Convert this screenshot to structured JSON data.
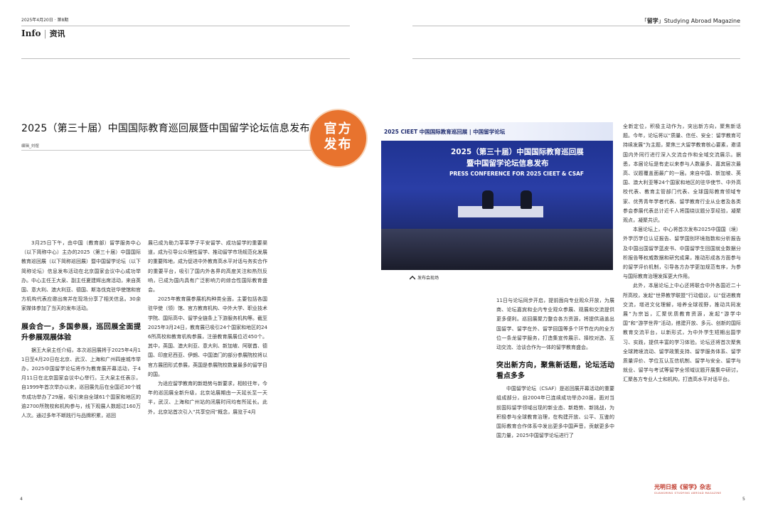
{
  "header": {
    "date_issue": "2025年4月20日 · 第8期",
    "section_en": "Info",
    "section_zh": "资讯",
    "magazine_bracket": "留学",
    "magazine_name": "Studying Abroad Magazine"
  },
  "article": {
    "title": "2025（第三十届）中国国际教育巡回展暨中国留学论坛信息发布",
    "editor": "编辑_刘煜",
    "badge": [
      "官方",
      "发布"
    ],
    "col1": {
      "p1": "3月25日下午，由中国（教育部）留学服务中心（以下简称中心）主办的2025（第三十届）中国国际教育巡回展（以下简称巡回展）暨中国留学论坛（以下简称论坛）信息发布活动在北京国家会议中心成功举办。中心主任王大泉、副主任夏建辉出席活动，来自英国、意大利、澳大利亚、德国、斯洛伐克驻华使馆和官方机构代表应邀出席并在现场分享了相关信息。30余家媒体参加了当天的发布活动。",
      "h1": "展会合一，多国参展，巡回展全面提升参展观展体验",
      "p2": "据王大泉主任介绍，本次巡回展将于2025年4月11日至4月20日在北京、武汉、上海和广州四座城市举办，2025中国留学论坛将作为教育展开幕活动，于4月11日在北京国家会议中心举行。王大泉主任表示，自1999年首次举办以来，巡回展先后在全国近30个城市成功举办了29届，吸引来自全球61个国家和地区的逾2700所院校和机构参与，线下观展人数超过160万人次。通过多年不断践行与品牌积累，巡回"
    },
    "col2": {
      "p1": "展已成为助力莘莘学子平安留学、成功留学的重要渠道，成为引导公众理性留学、推动留学市场规范化发展的重要阵地，成为促进中外教育高水平对话与务实合作的重要平台，吸引了国内外各界的高度关注和热烈反响，已成为国内具有广泛影响力的综合性国际教育盛会。",
      "p2": "2025年教育展参展机构种类全面，主要包括各国驻华使（领）馆、官方教育机构、中外大学、职业技术学院、国际高中、留学全链条上下游服务机构等。截至2025年3月24日，教育展已吸引24个国家和地区的246所高校和教育机构参展，注册教育展展位近450个。其中，英国、澳大利亚、意大利、新加坡、阿联酋、德国、印度尼西亚、伊朗、中国澳门的部分参展院校将以官方展团形式参展，英国是参展院校数量最多的留学目的国。",
      "p3": "为适应留学教育的新趋势与新要求，相较往年，今年的巡回展全新升级，北京站展期由一天延长至一天半，武汉、上海和广州站的闭展时间均有所延长。此外，北京站首次引入“共享空间”概念，展览于4月"
    },
    "col3": {
      "p1": "11日与论坛同步开启，提前面向专业观众开放，为展商、论坛嘉宾和业内专业观众参展、观展和交流提供更多便利。巡回展聚力整合各方资源，将提供涵盖出国留学、留学在外、留学回国等多个环节在内的全方位一条龙留学服务，打造集宣传展示、择校对选、互动交流、洽谈合作为一体的留学教育盛会。",
      "h1": "突出新方向，聚焦新话题，论坛活动看点多多",
      "p2": "中国留学论坛（CSAF）是巡回展开幕活动的重要组成部分，自2004年已连续成功举办20届，面对当前国际留学领域出现的新业态、新趋势、新挑战，为积极参与全球教育治理，在构建开放、公平、互鉴的国际教育合作体系中发出更多中国声音，贡献更多中国力量，2025中国留学论坛进行了"
    },
    "col4": {
      "p0": "全新定位，积极主动作为，突出新方向，聚焦新话题。今年，论坛将以“质量、信任、安全：留学教育可持续发展”为主题，聚焦三大留学教育核心要素，邀请国内外同行进行深入交流合作和全域交流展示。据悉，本届论坛是有史以来参与人数最多、嘉宾层次最高、议题覆盖面最广的一届。来自中国、新加坡、英国、澳大利亚等24个国家和地区的驻华使节、中外高校代表、教育主管部门代表、全球国际教育领域专家、优秀青年学者代表、留学教育行业从业者及各类参会参展代表总计近千人将围绕议题分享经验，凝聚观点，凝聚共识。",
      "p1": "本届论坛上，中心将首次发布2025中国国（境）外学历学位认证报告、留学国别环境指数和分析报告及中国出国留学蓝皮书、中国留学生回国就业数据分析报告等权威数据和研究成果，推动形成各方面参与的留学评价机制，引导各方办学更加规范有序，为参与国际教育治理发挥更大作用。",
      "p2": "此外，本届论坛上中心还将联合中外各国近二十所高校，发起“世界教学联盟”行动倡议，以“促进教育交流，增进文化理解，培养全球视野，推动共同发展”为宗旨，汇聚优质教育资源，发起“游学中国”和“游学世界”活动，搭建开放、多元、创新的国际教育交流平台，以新形式，为中外学生短期出国学习、实践，提供丰富的学习体验。论坛还将首次聚焦全球跨境流动、留学政策支持、留学服务体系、留学质量评价、学位互认互信机制、留学与安全、留学与就业、留学与考试等留学全领域议题开展集中研讨，汇聚各方专业人士和机构，打造高水平对话平台。"
    }
  },
  "photo": {
    "backdrop_title_line1": "2025（第三十届）中国国际教育巡回展",
    "backdrop_title_line2": "暨中国留学论坛信息发布",
    "backdrop_title_en": "PRESS CONFERENCE FOR 2025 CIEET & CSAF",
    "banner_text": "2025 CIEET  中国国际教育巡回展  |  中国留学论坛",
    "caption": "发布会现场"
  },
  "footer": {
    "page_left": "4",
    "page_right": "5",
    "logo_text": "光明日报《留学》杂志",
    "logo_sub": "GUANGMING STUDYING ABROAD MAGAZINE"
  },
  "colors": {
    "badge_orange": "#e8732e",
    "logo_red": "#c0392b",
    "photo_blue": "#2a3ea6"
  }
}
